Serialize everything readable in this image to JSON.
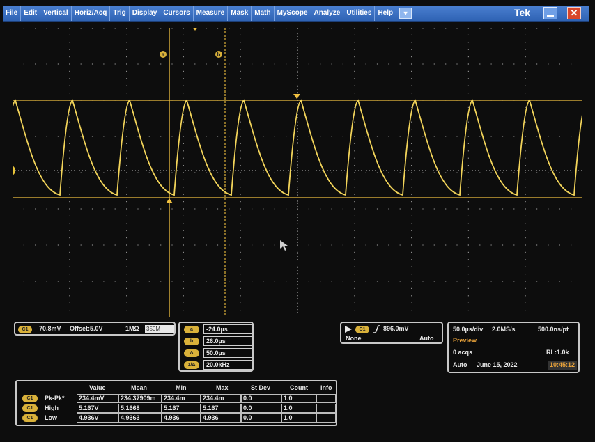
{
  "menu": {
    "items": [
      "File",
      "Edit",
      "Vertical",
      "Horiz/Acq",
      "Trig",
      "Display",
      "Cursors",
      "Measure",
      "Mask",
      "Math",
      "MyScope",
      "Analyze",
      "Utilities",
      "Help"
    ],
    "brand": "Tek"
  },
  "cursors": {
    "label_a": "a",
    "label_b": "b"
  },
  "channel": {
    "badge": "C1",
    "scale": "70.8mV",
    "offset": "Offset:5.0V",
    "impedance": "1MΩ",
    "bandwidth": "350M"
  },
  "cursor_readout": [
    {
      "badge": "a",
      "value": "-24.0µs"
    },
    {
      "badge": "b",
      "value": "26.0µs"
    },
    {
      "badge": "Δ",
      "value": "50.0µs"
    },
    {
      "badge": "1/Δ",
      "value": "20.0kHz"
    }
  ],
  "trigger": {
    "source_badge": "C1",
    "level": "896.0mV",
    "coupling": "None",
    "mode": "Auto"
  },
  "acquisition": {
    "timebase": "50.0µs/div",
    "sample_rate": "2.0MS/s",
    "resolution": "500.0ns/pt",
    "state": "Preview",
    "acqs": "0 acqs",
    "record_length": "RL:1.0k",
    "run_mode": "Auto",
    "date": "June 15, 2022",
    "time": "10:45:12"
  },
  "measurements": {
    "headers": [
      "Value",
      "Mean",
      "Min",
      "Max",
      "St Dev",
      "Count",
      "Info"
    ],
    "rows": [
      {
        "badge": "C1",
        "name": "Pk-Pk*",
        "cells": [
          "234.4mV",
          "234.37909m",
          "234.4m",
          "234.4m",
          "0.0",
          "1.0",
          ""
        ]
      },
      {
        "badge": "C1",
        "name": "High",
        "cells": [
          "5.167V",
          "5.1668",
          "5.167",
          "5.167",
          "0.0",
          "1.0",
          ""
        ]
      },
      {
        "badge": "C1",
        "name": "Low",
        "cells": [
          "4.936V",
          "4.9363",
          "4.936",
          "4.936",
          "0.0",
          "1.0",
          ""
        ]
      }
    ]
  },
  "colors": {
    "trace": "#f2d45a",
    "cursor": "#f0c040",
    "grid": "#9a9a9a",
    "menubar": "#3c70c4"
  }
}
